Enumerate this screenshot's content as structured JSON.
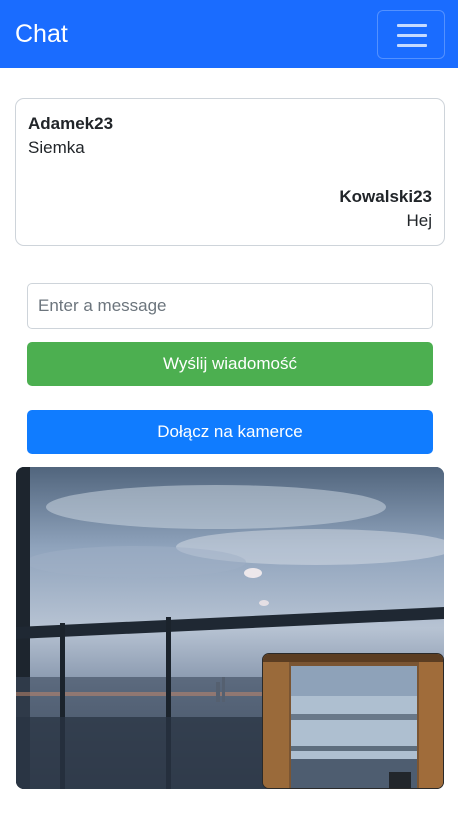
{
  "navbar": {
    "brand": "Chat",
    "toggler_icon": "hamburger-menu-icon"
  },
  "chat": {
    "messages": [
      {
        "author": "Adamek23",
        "text": "Siemka",
        "align": "left"
      },
      {
        "author": "Kowalski23",
        "text": "Hej",
        "align": "right"
      }
    ]
  },
  "composer": {
    "placeholder": "Enter a message",
    "value": "",
    "send_label": "Wyślij wiadomość"
  },
  "camera": {
    "join_label": "Dołącz na kamerce"
  },
  "colors": {
    "navbar": "#1a6cff",
    "send_button": "#4caf50",
    "camera_button": "#107cff"
  }
}
